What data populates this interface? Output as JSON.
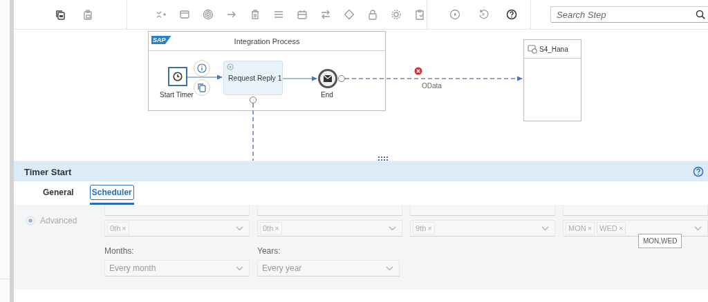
{
  "toolbar": {
    "search": {
      "placeholder": "Search Step"
    }
  },
  "diagram": {
    "process": {
      "logo": "SAP",
      "title": "Integration Process"
    },
    "steps": [
      {
        "kind": "timer",
        "label": "Start Timer",
        "selected": true
      },
      {
        "kind": "request_reply",
        "label": "Request Reply 1",
        "selected": false
      },
      {
        "kind": "end",
        "label": "End",
        "selected": false
      }
    ],
    "connection": {
      "label": "OData",
      "error": true
    },
    "receiver": {
      "label": "S4_Hana"
    }
  },
  "panel": {
    "title": "Timer Start",
    "tabs": [
      {
        "label": "General",
        "selected": false
      },
      {
        "label": "Scheduler",
        "selected": true
      }
    ],
    "radio": {
      "label": "Advanced",
      "selected": true
    },
    "remove_glyph": "×",
    "fields": [
      {
        "tokens": [
          "0th"
        ]
      },
      {
        "tokens": [
          "0th"
        ]
      },
      {
        "tokens": [
          "9th"
        ]
      },
      {
        "tokens": [
          "MON",
          "WED"
        ]
      }
    ],
    "dropdowns": [
      {
        "label": "Months:",
        "value": "Every month"
      },
      {
        "label": "Years:",
        "value": "Every year"
      }
    ],
    "tooltip": "MON,WED"
  }
}
